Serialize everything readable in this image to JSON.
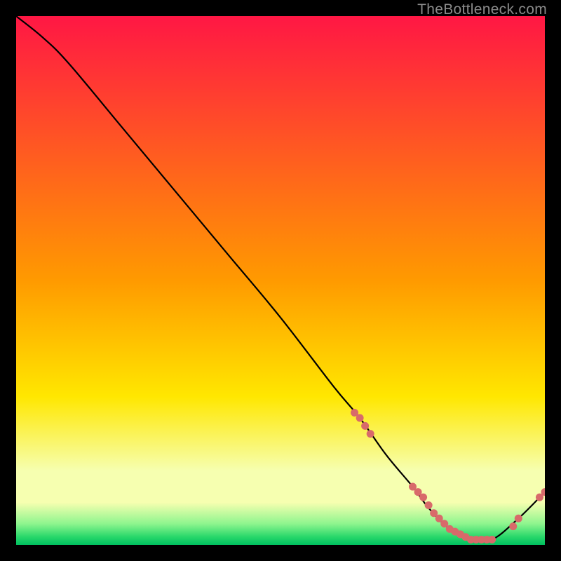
{
  "watermark": "TheBottleneck.com",
  "colors": {
    "curve": "#000000",
    "marker": "#d86a6a",
    "top": "#ff1744",
    "orange": "#ff9a00",
    "yellow": "#ffe700",
    "pale": "#f6ffb0",
    "green1": "#8ef58e",
    "green2": "#28d76a",
    "greenBottom": "#00c060"
  },
  "chart_data": {
    "type": "line",
    "title": "",
    "xlabel": "",
    "ylabel": "",
    "xlim": [
      0,
      100
    ],
    "ylim": [
      0,
      100
    ],
    "series": [
      {
        "name": "bottleneck-curve",
        "x": [
          0,
          5,
          10,
          20,
          30,
          40,
          50,
          60,
          65,
          70,
          75,
          78,
          82,
          86,
          90,
          95,
          100
        ],
        "y": [
          100,
          96,
          91,
          79,
          67,
          55,
          43,
          30,
          24,
          17,
          11,
          7,
          3,
          1,
          1,
          5,
          10
        ]
      }
    ],
    "markers": {
      "name": "highlighted-points",
      "x": [
        64,
        65,
        66,
        67,
        75,
        76,
        77,
        78,
        79,
        80,
        81,
        82,
        83,
        84,
        85,
        86,
        87,
        88,
        89,
        90,
        94,
        95,
        99,
        100
      ],
      "y": [
        25,
        24,
        22.5,
        21,
        11,
        10,
        9,
        7.5,
        6,
        5,
        4,
        3,
        2.5,
        2,
        1.5,
        1,
        1,
        1,
        1,
        1,
        3.5,
        5,
        9,
        10
      ]
    }
  }
}
